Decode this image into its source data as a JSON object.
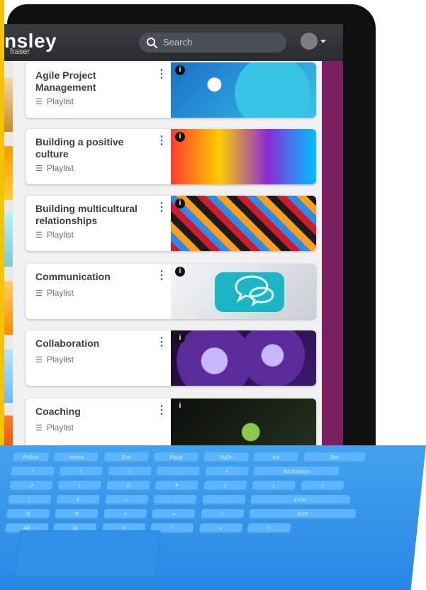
{
  "app": {
    "logo_text": "nsley",
    "logo_sub": "fraser",
    "search_placeholder": "Search"
  },
  "cards": [
    {
      "title": "Agile Project Management",
      "subtitle": "Playlist",
      "thumb_colors": [
        "#1b6fc9",
        "#37c3e6",
        "#ffffff"
      ]
    },
    {
      "title": "Building a positive culture",
      "subtitle": "Playlist",
      "thumb_colors": [
        "#ff3b2d",
        "#ffcc00",
        "#8a2bd8"
      ]
    },
    {
      "title": "Building multicultural relationships",
      "subtitle": "Playlist",
      "thumb_colors": [
        "#d11a2a",
        "#2c8be8",
        "#ff9f1a"
      ]
    },
    {
      "title": "Communication",
      "subtitle": "Playlist",
      "thumb_colors": [
        "#d8dde2",
        "#1bb6c5",
        "#9aa1a8"
      ]
    },
    {
      "title": "Collaboration",
      "subtitle": "Playlist",
      "thumb_colors": [
        "#5b2a9b",
        "#c7b7ff",
        "#1b0b2b"
      ]
    },
    {
      "title": "Coaching",
      "subtitle": "Playlist",
      "thumb_colors": [
        "#26321f",
        "#8ac94b",
        "#0b0f0b"
      ]
    }
  ],
  "keyboard": {
    "row1": [
      "PrtScn",
      "Home",
      "End",
      "PgUp",
      "PgDn",
      "Ins",
      "Del"
    ],
    "row2": [
      "*",
      "(",
      ")",
      "_",
      "+",
      "Backspace"
    ],
    "row3": [
      "U",
      "I",
      "O",
      "P",
      "{",
      "}",
      "|"
    ],
    "row4": [
      "J",
      "K",
      "L",
      ":",
      "\"",
      "Enter"
    ],
    "row5": [
      "N",
      "M",
      "<",
      ">",
      "?",
      "Shift"
    ],
    "row6": [
      "Alt",
      "▤",
      "<",
      "^",
      "v",
      ">"
    ]
  },
  "theme": {
    "accent_purple": "#7a1f5f",
    "menu_teal": "#1f6f8b"
  }
}
